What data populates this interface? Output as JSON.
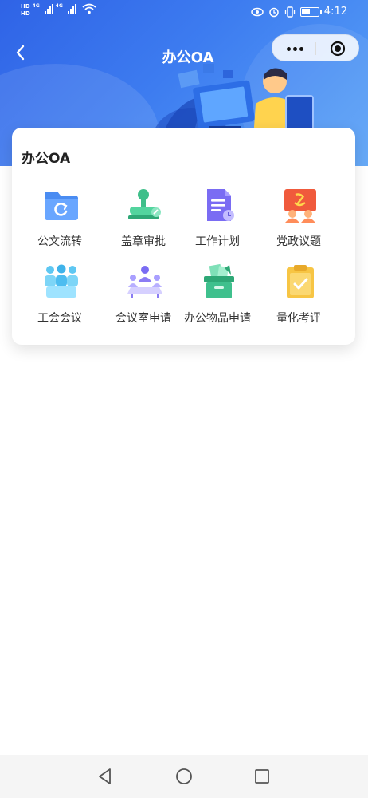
{
  "status_bar": {
    "hd_top": "HD",
    "hd_bottom": "HD",
    "net1": "4G",
    "net2": "4G",
    "battery_level": 0.55,
    "time": "4:12"
  },
  "header": {
    "title": "办公OA"
  },
  "card": {
    "title": "办公OA",
    "apps": [
      {
        "label": "公文流转",
        "icon": "folder-refresh-icon",
        "color": "#4a8cf2"
      },
      {
        "label": "盖章审批",
        "icon": "stamp-icon",
        "color": "#4fcf9b"
      },
      {
        "label": "工作计划",
        "icon": "document-clock-icon",
        "color": "#7a6cf3"
      },
      {
        "label": "党政议题",
        "icon": "party-emblem-icon",
        "color": "#f05a3c"
      },
      {
        "label": "工会会议",
        "icon": "people-group-icon",
        "color": "#5ec7f2"
      },
      {
        "label": "会议室申请",
        "icon": "meeting-room-icon",
        "color": "#8b7cf4"
      },
      {
        "label": "办公物品申请",
        "icon": "supplies-box-icon",
        "color": "#3fc08d"
      },
      {
        "label": "量化考评",
        "icon": "clipboard-check-icon",
        "color": "#f7c544"
      }
    ]
  },
  "colors": {
    "header_start": "#2f63e6",
    "header_end": "#5aa3f7",
    "accent": "#4a8cf2"
  }
}
